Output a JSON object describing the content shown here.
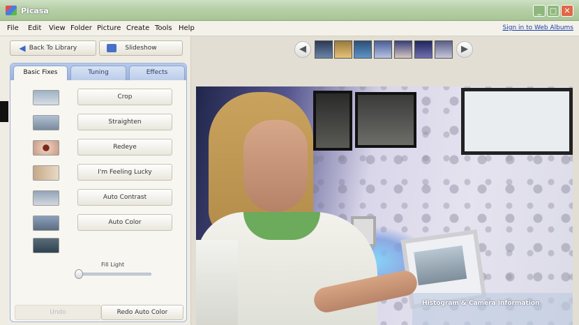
{
  "window": {
    "title": "Picasa",
    "min": "_",
    "max": "□",
    "close": "✕"
  },
  "menu": {
    "items": [
      "File",
      "Edit",
      "View",
      "Folder",
      "Picture",
      "Create",
      "Tools",
      "Help"
    ],
    "signin": "Sign in to Web Albums"
  },
  "toolbar": {
    "back_label": "Back To Library",
    "slideshow_label": "Slideshow"
  },
  "tabs": [
    "Basic Fixes",
    "Tuning",
    "Effects"
  ],
  "fixes": [
    "Crop",
    "Straighten",
    "Redeye",
    "I'm Feeling Lucky",
    "Auto Contrast",
    "Auto Color"
  ],
  "fill_light": {
    "label": "Fill Light",
    "value": 0
  },
  "undo_label": "Undo",
  "redo_label": "Redo Auto Color",
  "filmstrip": {
    "prev": "◀",
    "next": "▶"
  },
  "photo_overlay": "Histogram & Camera Information",
  "colors": {
    "accent": "#4870c8",
    "tab_bar": "#9bb2dc",
    "title_bar": "#b9d1a9",
    "close": "#e0684a"
  }
}
